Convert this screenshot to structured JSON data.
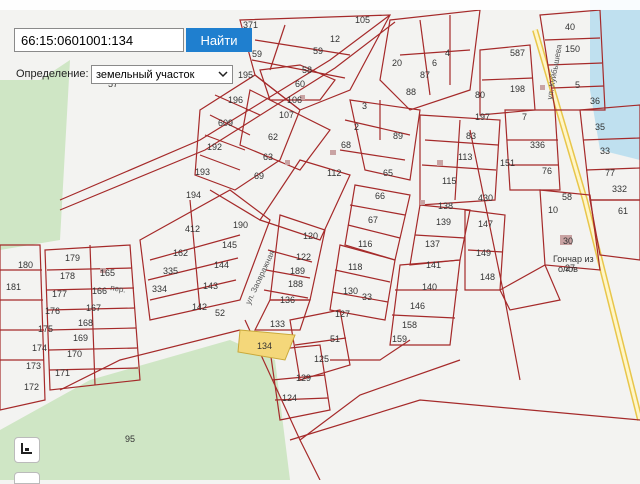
{
  "search": {
    "value": "66:15:0601001:134",
    "button_label": "Найти"
  },
  "definition": {
    "label": "Определение:",
    "selected": "земельный участок"
  },
  "map": {
    "highlight_parcel": "134",
    "area_label": "95",
    "streets": [
      "ул. Куйбышева",
      "пер.",
      "ул. Заовражная"
    ],
    "poi": [
      "Гончар из",
      "олов"
    ],
    "parcels": [
      "40",
      "150",
      "5",
      "36",
      "35",
      "33",
      "77",
      "332",
      "61",
      "59",
      "105",
      "12",
      "20",
      "4",
      "587",
      "198",
      "6",
      "87",
      "88",
      "80",
      "197",
      "7",
      "3",
      "2",
      "89",
      "83",
      "113",
      "336",
      "76",
      "151",
      "112",
      "68",
      "65",
      "115",
      "430",
      "66",
      "138",
      "139",
      "147",
      "67",
      "116",
      "137",
      "149",
      "118",
      "141",
      "148",
      "130",
      "140",
      "146",
      "127",
      "158",
      "159",
      "120",
      "122",
      "189",
      "188",
      "136",
      "133",
      "51",
      "125",
      "129",
      "124",
      "190",
      "145",
      "144",
      "143",
      "142",
      "162",
      "335",
      "334",
      "412",
      "194",
      "193",
      "69",
      "63",
      "62",
      "192",
      "609",
      "107",
      "106",
      "196",
      "195",
      "60",
      "58",
      "57",
      "179",
      "178",
      "177",
      "175",
      "174",
      "173",
      "172",
      "171",
      "170",
      "169",
      "168",
      "167",
      "166",
      "165",
      "176",
      "180",
      "181",
      "10",
      "30",
      "27",
      "52",
      "58",
      "33",
      "371",
      "59"
    ]
  },
  "icons": {
    "tool": "layers-icon",
    "dropdown": "chevron-down-icon"
  },
  "colors": {
    "parcel_border": "#a52a2a",
    "highlight": "#f4d77a",
    "button": "#1f7fcf",
    "vegetation": "#cfe6c5",
    "road": "#e8c64a"
  }
}
